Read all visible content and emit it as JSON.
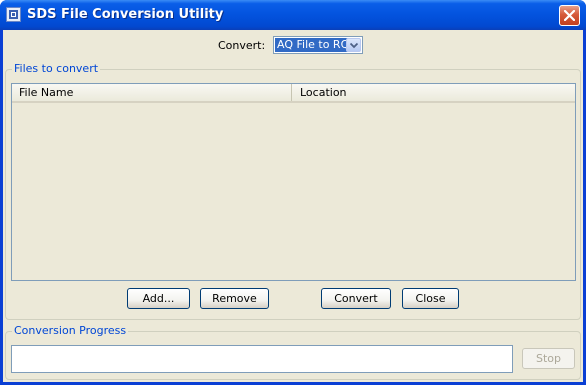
{
  "window": {
    "title": "SDS File Conversion Utility",
    "icon": "app-icon",
    "close_icon": "close-x-icon"
  },
  "convert": {
    "label": "Convert:",
    "selected": "AQ File to RQ",
    "arrow_icon": "chevron-down-icon"
  },
  "files_group": {
    "title": "Files to convert",
    "columns": [
      "File Name",
      "Location"
    ],
    "rows": []
  },
  "buttons": {
    "add": "Add...",
    "remove": "Remove",
    "convert": "Convert",
    "close": "Close"
  },
  "progress_group": {
    "title": "Conversion Progress",
    "stop": "Stop"
  },
  "colors": {
    "title_bar": "#0353de",
    "client_bg": "#ece9d8",
    "group_title": "#0046d5",
    "selection": "#316ac5"
  }
}
